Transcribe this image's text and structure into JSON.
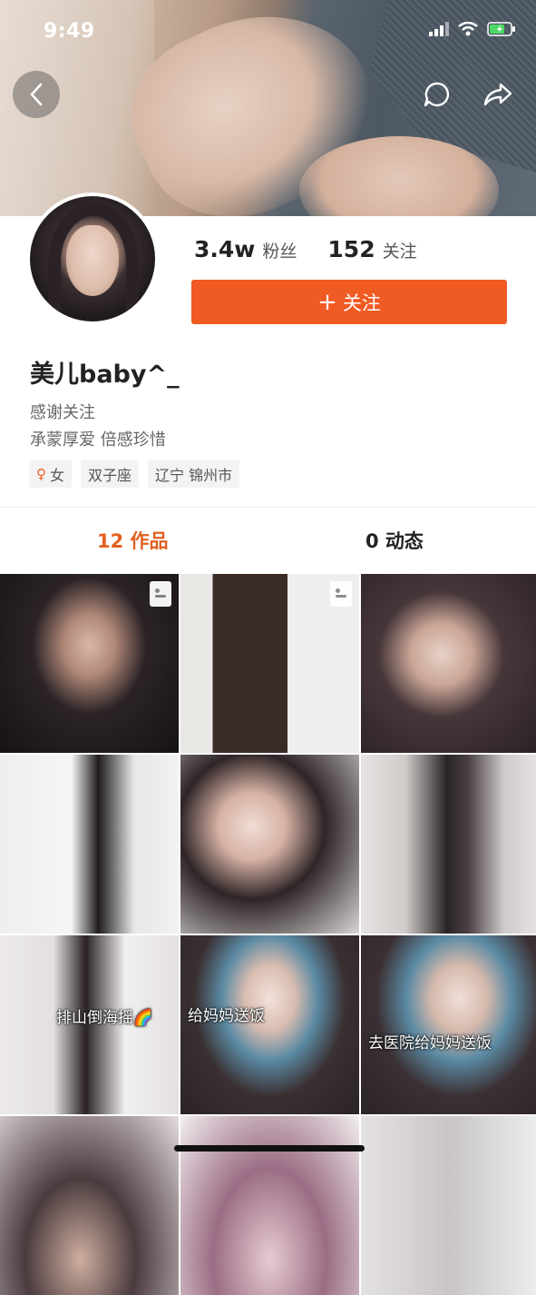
{
  "status_bar": {
    "time": "9:49"
  },
  "header": {
    "back_icon": "chevron-left-icon",
    "message_icon": "speech-bubble-icon",
    "share_icon": "share-arrow-icon"
  },
  "profile": {
    "followers_count": "3.4w",
    "followers_label": "粉丝",
    "following_count": "152",
    "following_label": "关注",
    "follow_button_plus": "+",
    "follow_button_label": "关注",
    "name": "美儿baby^_",
    "bio_line1": "感谢关注",
    "bio_line2": "承蒙厚爱 倍感珍惜",
    "tags": {
      "gender_icon": "♀",
      "gender": "女",
      "zodiac": "双子座",
      "location": "辽宁 锦州市"
    }
  },
  "tabs": {
    "works": "12 作品",
    "moments": "0 动态"
  },
  "grid": {
    "captions": {
      "c7": "排山倒海摇🌈",
      "c8": "给妈妈送饭",
      "c9": "去医院给妈妈送饭"
    }
  },
  "colors": {
    "accent": "#f05a23",
    "tab_active": "#e2601f"
  }
}
